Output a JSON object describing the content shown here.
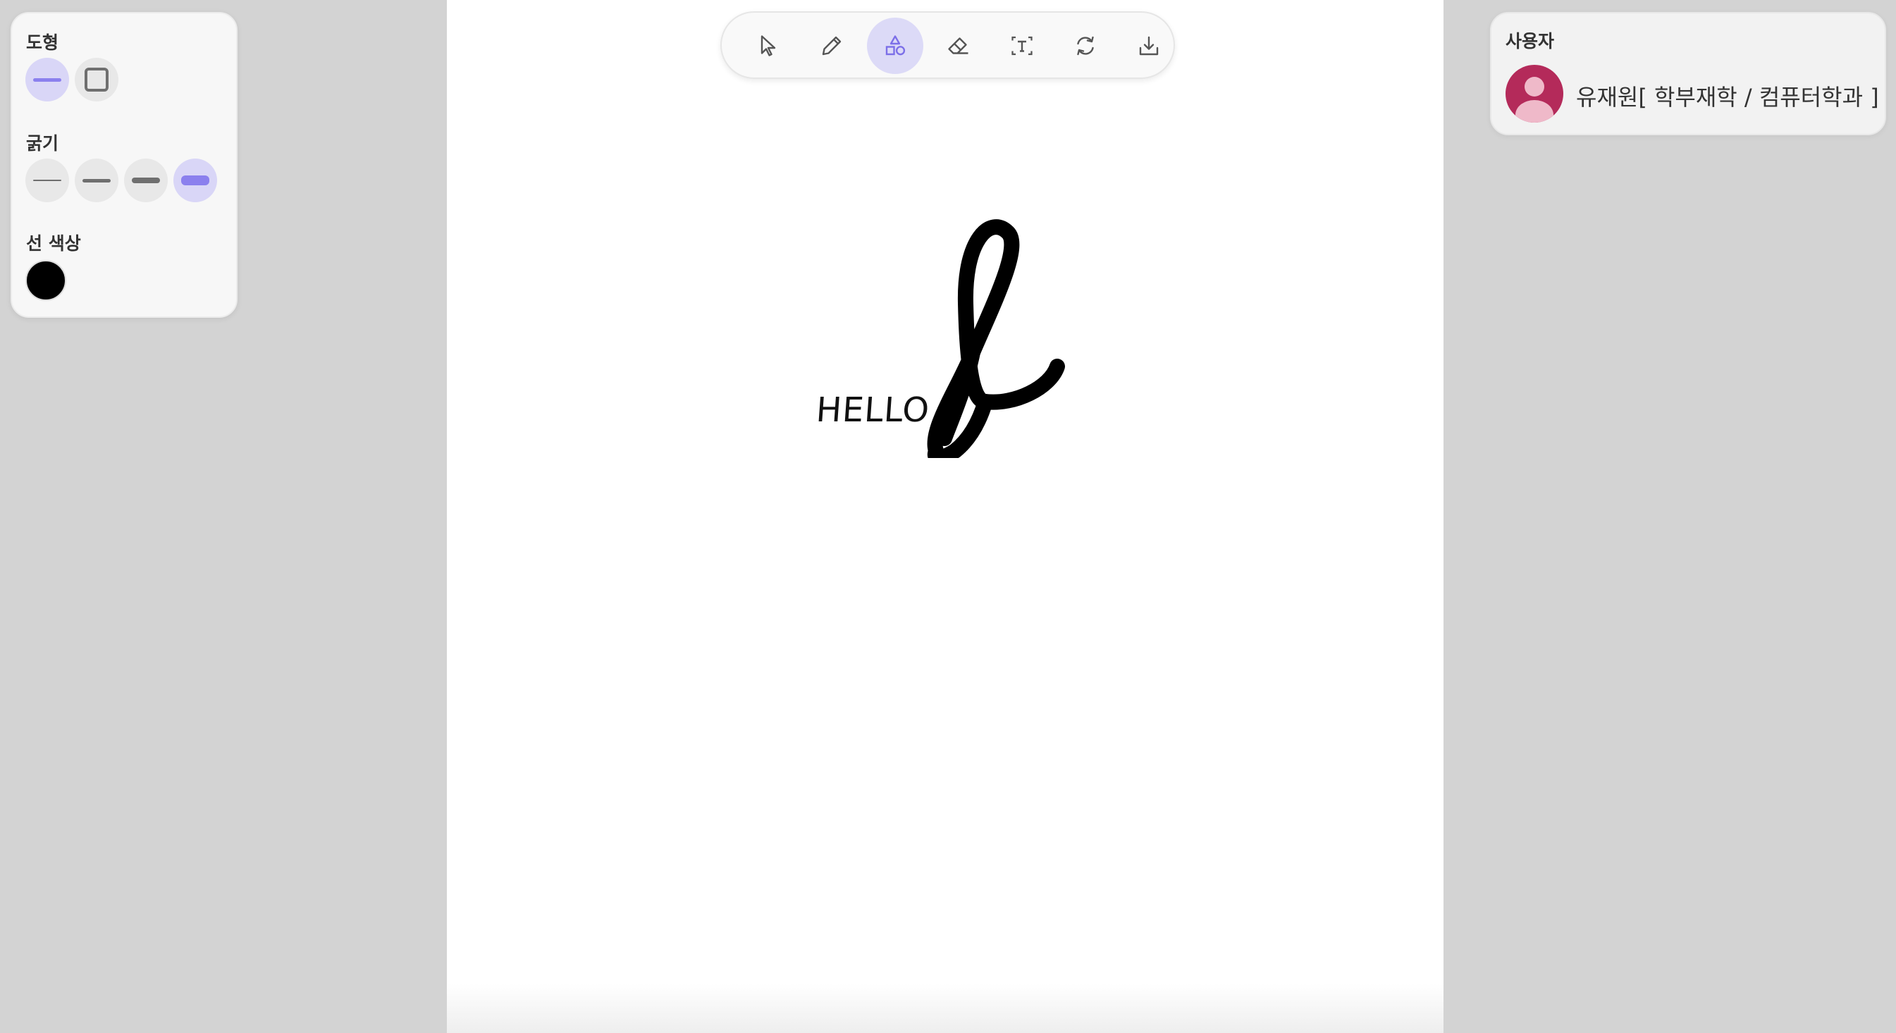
{
  "left_panel": {
    "shape_title": "도형",
    "thickness_title": "굵기",
    "line_color_title": "선 색상",
    "selected_color": "#000000"
  },
  "toolbar": {
    "tools": [
      "select-icon",
      "pencil-icon",
      "shapes-icon",
      "eraser-icon",
      "text-icon",
      "refresh-icon",
      "download-icon"
    ],
    "active_tool": "shapes-icon"
  },
  "user_panel": {
    "title": "사용자",
    "user_name": "유재원[ 학부재학 / 컴퓨터학과 ]",
    "avatar_color": "#b42a5a"
  },
  "canvas": {
    "text": "HELLO"
  },
  "colors": {
    "accent": "#8b80ee",
    "accent_bg": "#d9d6f7",
    "background": "#d3d3d3",
    "canvas": "#ffffff"
  }
}
